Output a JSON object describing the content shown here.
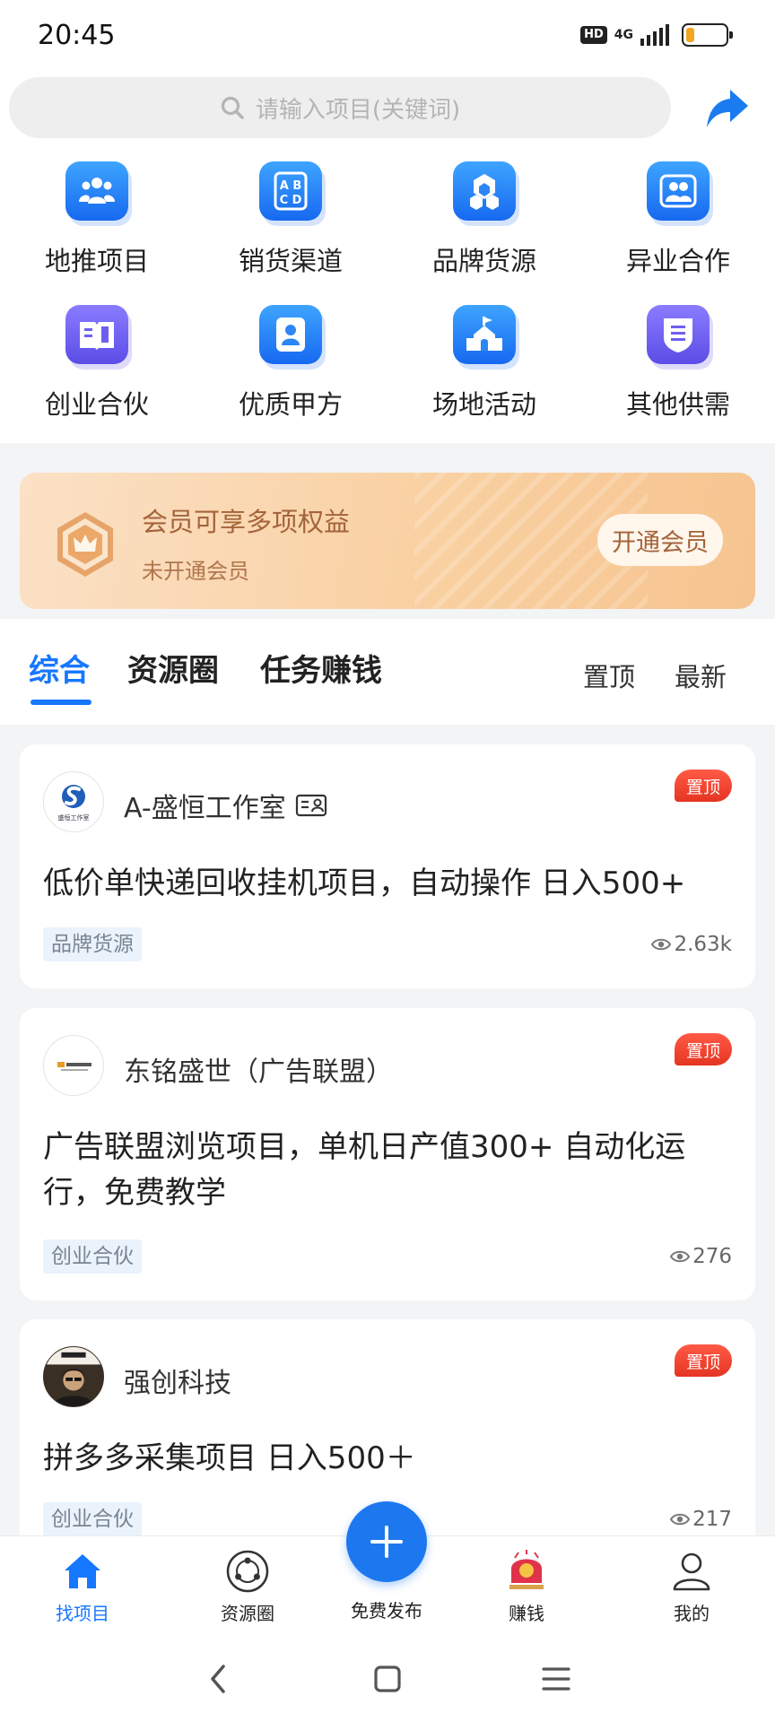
{
  "status_bar": {
    "time": "20:45",
    "hd": "HD",
    "network": "4G"
  },
  "search": {
    "placeholder": "请输入项目(关键词)"
  },
  "categories": [
    {
      "label": "地推项目",
      "icon": "people-group-icon"
    },
    {
      "label": "销货渠道",
      "icon": "abcd-icon"
    },
    {
      "label": "品牌货源",
      "icon": "hexagon-cluster-icon"
    },
    {
      "label": "异业合作",
      "icon": "two-persons-icon"
    },
    {
      "label": "创业合伙",
      "icon": "book-icon"
    },
    {
      "label": "优质甲方",
      "icon": "person-badge-icon"
    },
    {
      "label": "场地活动",
      "icon": "venue-building-icon"
    },
    {
      "label": "其他供需",
      "icon": "shield-list-icon"
    }
  ],
  "vip": {
    "title": "会员可享多项权益",
    "subtitle": "未开通会员",
    "button": "开通会员"
  },
  "tabs": [
    "综合",
    "资源圈",
    "任务赚钱"
  ],
  "sort_options": [
    "置顶",
    "最新"
  ],
  "posts": [
    {
      "author": "A-盛恒工作室",
      "verified": true,
      "pinned": "置顶",
      "title": "低价单快递回收挂机项目，自动操作 日入500+",
      "tag": "品牌货源",
      "views": "2.63k",
      "avatar_text": "盛恒工作室"
    },
    {
      "author": "东铭盛世（广告联盟）",
      "verified": false,
      "pinned": "置顶",
      "title": "广告联盟浏览项目，单机日产值300+ 自动化运行，免费教学",
      "tag": "创业合伙",
      "views": "276"
    },
    {
      "author": "强创科技",
      "verified": false,
      "pinned": "置顶",
      "title": "拼多多采集项目 日入500＋",
      "tag": "创业合伙",
      "views": "217"
    }
  ],
  "bottom_nav": [
    {
      "label": "找项目",
      "icon": "home-icon",
      "active": true
    },
    {
      "label": "资源圈",
      "icon": "circle-network-icon",
      "active": false
    },
    {
      "label": "免费发布",
      "icon": "plus-icon",
      "active": false
    },
    {
      "label": "赚钱",
      "icon": "red-envelope-icon",
      "active": false
    },
    {
      "label": "我的",
      "icon": "user-icon",
      "active": false
    }
  ],
  "colors": {
    "accent": "#1677ff",
    "pin_red": "#e53523",
    "vip_bg": "#f9cf9f",
    "vip_text": "#a4643a"
  }
}
